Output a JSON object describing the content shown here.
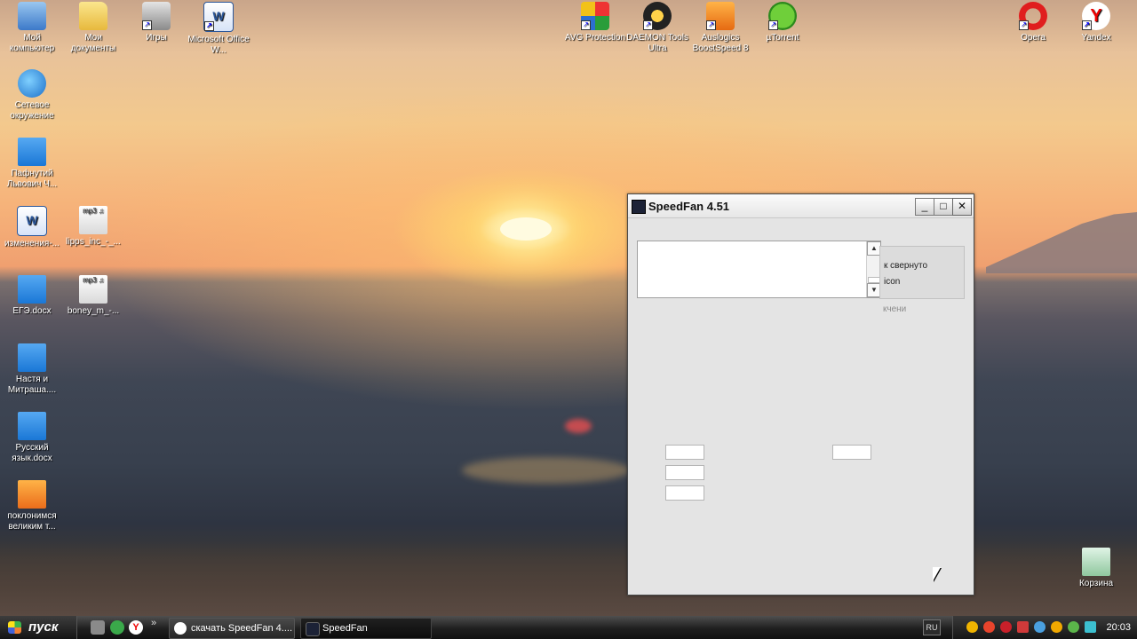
{
  "desktop": {
    "icons": [
      {
        "label": "Мой компьютер",
        "type": "pc"
      },
      {
        "label": "Мои документы",
        "type": "folder"
      },
      {
        "label": "Игры",
        "type": "games"
      },
      {
        "label": "Microsoft Office W...",
        "type": "word"
      },
      {
        "label": "AVG Protection",
        "type": "avg"
      },
      {
        "label": "DAEMON Tools Ultra",
        "type": "daemon"
      },
      {
        "label": "Auslogics BoostSpeed 8",
        "type": "ausl"
      },
      {
        "label": "µTorrent",
        "type": "ut"
      },
      {
        "label": "Opera",
        "type": "opera"
      },
      {
        "label": "Yandex",
        "type": "yandex"
      },
      {
        "label": "Сетевое окружение",
        "type": "net"
      },
      {
        "label": "Пафнутий Львович Ч...",
        "type": "docx"
      },
      {
        "label": "изменения-...",
        "type": "word"
      },
      {
        "label": "lipps_inc_-_...",
        "type": "mp3"
      },
      {
        "label": "ЕГЭ.docx",
        "type": "docx"
      },
      {
        "label": "boney_m_-...",
        "type": "mp3"
      },
      {
        "label": "Настя и Митраша....",
        "type": "docx"
      },
      {
        "label": "Русский язык.docx",
        "type": "docx"
      },
      {
        "label": "поклонимся великим т...",
        "type": "ppt"
      },
      {
        "label": "Корзина",
        "type": "bin"
      }
    ]
  },
  "speedfan": {
    "title": "SpeedFan 4.51",
    "minimize": "_",
    "maximize": "□",
    "close": "✕",
    "scroll_up": "▲",
    "scroll_down": "▼",
    "options": [
      "к свернуто",
      "icon",
      "кчени"
    ]
  },
  "taskbar": {
    "start_label": "пуск",
    "chevron": "»",
    "tasks": [
      {
        "label": "скачать SpeedFan 4...."
      },
      {
        "label": "SpeedFan"
      }
    ],
    "language": "RU",
    "clock": "20:03"
  }
}
